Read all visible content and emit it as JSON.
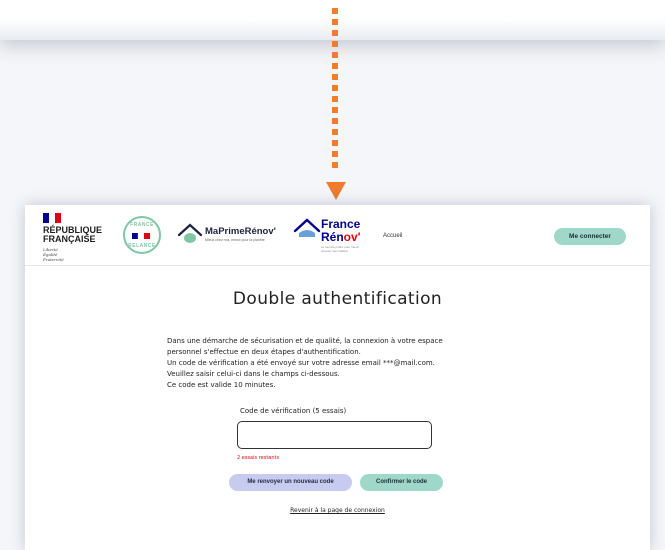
{
  "header": {
    "republique": [
      "RÉPUBLIQUE",
      "FRANÇAISE"
    ],
    "motto": [
      "Liberté",
      "Égalité",
      "Fraternité"
    ],
    "relance_top": "FRANCE",
    "relance_bottom": "RELANCE",
    "maprimerenov_name": "MaPrimeRénov'",
    "maprimerenov_tagline": "Mieux chez moi, mieux pour la planète",
    "france_renov_line1": "France",
    "france_renov_line2_a": "Rén",
    "france_renov_line2_b": "ov'",
    "france_renov_tagline": "Le service public pour mieux rénover mon habitat",
    "nav_home": "Accueil",
    "login_button": "Me connecter"
  },
  "page": {
    "title": "Double authentification",
    "message_lines": [
      "Dans une démarche de sécurisation et de qualité, la connexion à votre espace",
      "personnel s'effectue en deux étapes d'authentification.",
      "Un code de vérification a été envoyé sur votre adresse email ***@mail.com.",
      "Veuillez saisir celui-ci dans le champs ci-dessous.",
      "Ce code est valide 10 minutes."
    ],
    "code_label": "Code de vérification (5 essais)",
    "code_value": "",
    "attempts_left": "2 essais restants",
    "resend_button": "Me renvoyer un nouveau code",
    "confirm_button": "Confirmer le code",
    "back_link": "Revenir à la page de connexion"
  },
  "colors": {
    "arrow": "#ef7c2f",
    "mint_button": "#9fd8c8",
    "lavender_button": "#c8cbf0",
    "error_red": "#e1000f",
    "marianne_blue": "#000091"
  },
  "icons": [
    "maison-icon",
    "france-renov-house-icon",
    "flag-icon"
  ]
}
